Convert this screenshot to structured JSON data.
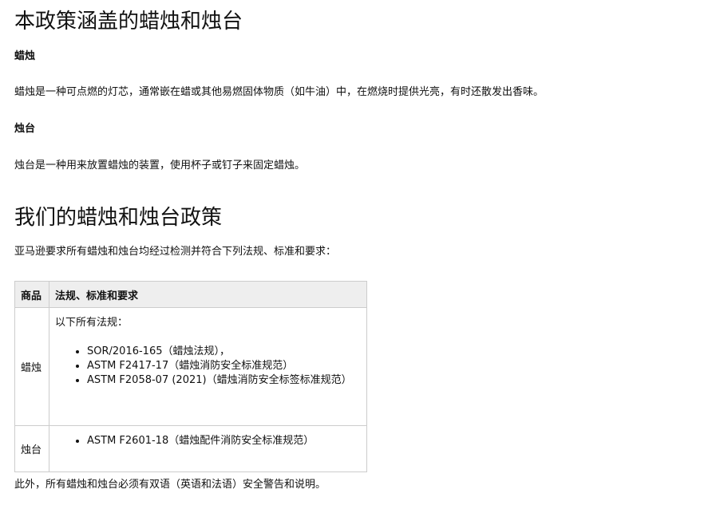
{
  "section1": {
    "title": "本政策涵盖的蜡烛和烛台",
    "candle_heading": "蜡烛",
    "candle_definition": "蜡烛是一种可点燃的灯芯，通常嵌在蜡或其他易燃固体物质（如牛油）中，在燃烧时提供光亮，有时还散发出香味。",
    "holder_heading": "烛台",
    "holder_definition": "烛台是一种用来放置蜡烛的装置，使用杯子或钉子来固定蜡烛。"
  },
  "section2": {
    "title": "我们的蜡烛和烛台政策",
    "intro": "亚马逊要求所有蜡烛和烛台均经过检测并符合下列法规、标准和要求：",
    "table": {
      "headers": [
        "商品",
        "法规、标准和要求"
      ],
      "rows": [
        {
          "product": "蜡烛",
          "intro": "以下所有法规：",
          "items": [
            "SOR/2016-165（蜡烛法规），",
            "ASTM F2417-17（蜡烛消防安全标准规范）",
            "ASTM F2058-07 (2021)（蜡烛消防安全标签标准规范）"
          ]
        },
        {
          "product": "烛台",
          "intro": "",
          "items": [
            "ASTM F2601-18（蜡烛配件消防安全标准规范）"
          ]
        }
      ]
    },
    "footer": "此外，所有蜡烛和烛台必须有双语（英语和法语）安全警告和说明。"
  }
}
